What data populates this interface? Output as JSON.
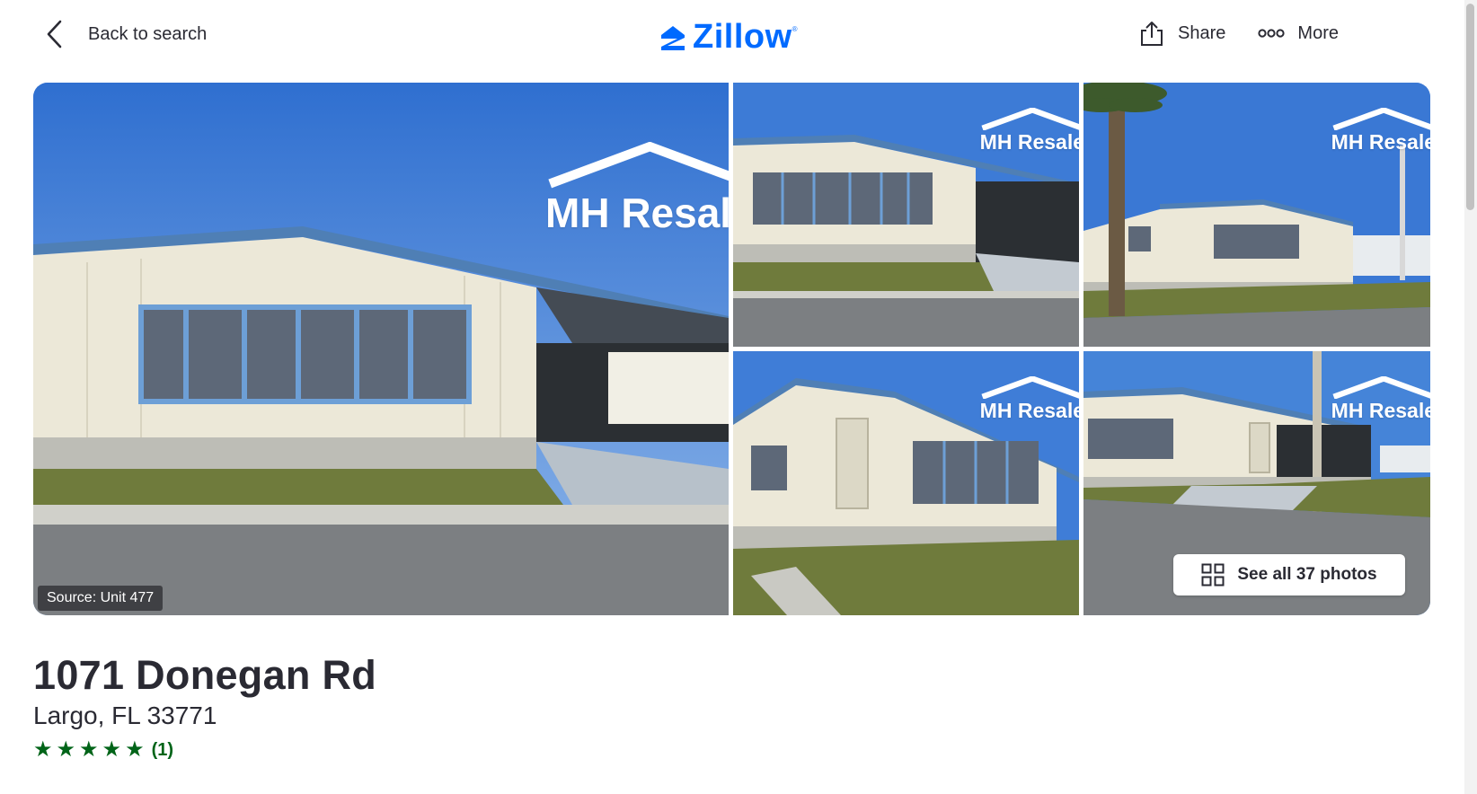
{
  "header": {
    "back_label": "Back to search",
    "logo_text": "Zillow",
    "share_label": "Share",
    "more_label": "More",
    "icons": {
      "back": "chevron-left-icon",
      "logo": "zillow-house-icon",
      "share": "share-icon",
      "more": "more-dots-icon"
    }
  },
  "gallery": {
    "watermark": "MH Resale",
    "source_label": "Source: Unit 477",
    "see_all_label": "See all 37 photos",
    "see_all_icon": "grid-icon"
  },
  "listing": {
    "address": "1071 Donegan Rd",
    "city_state_zip": "Largo, FL 33771",
    "rating_stars": 5,
    "rating_count": "(1)"
  },
  "colors": {
    "brand_blue": "#006aff",
    "text": "#2a2a33",
    "rating_green": "#006418"
  }
}
